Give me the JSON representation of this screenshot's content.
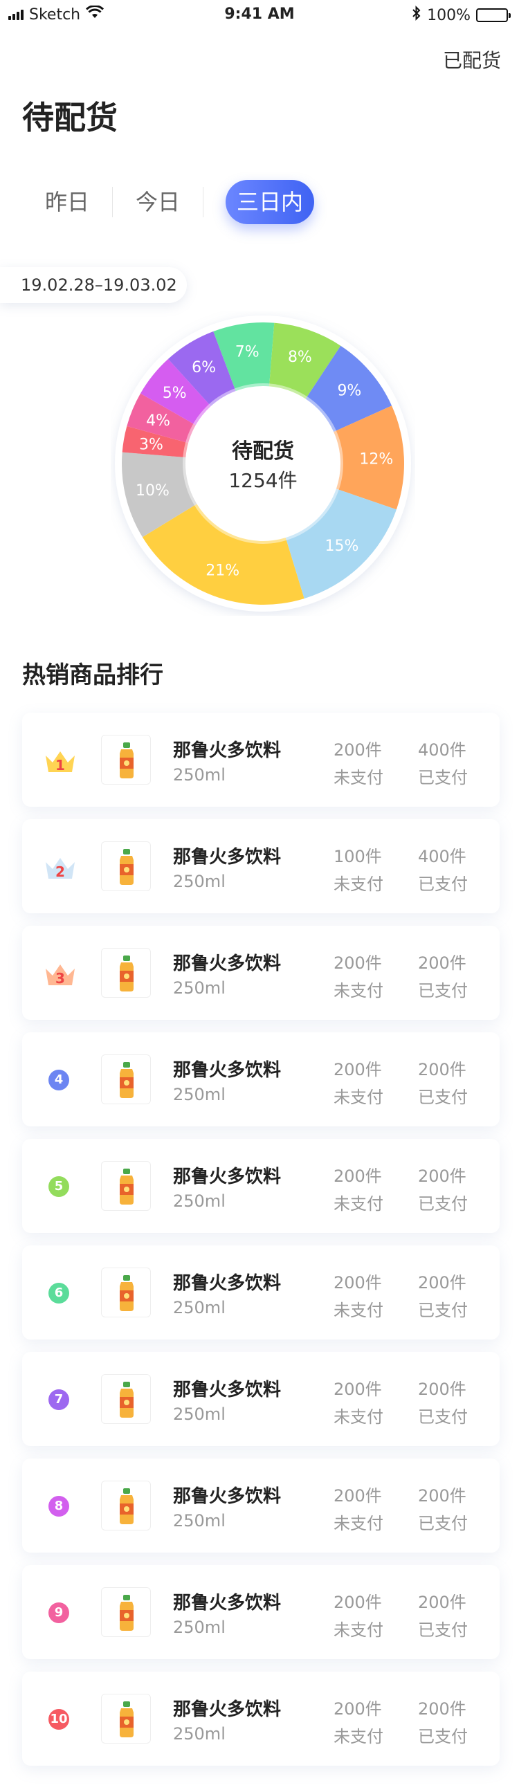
{
  "status_bar": {
    "carrier": "Sketch",
    "time": "9:41 AM",
    "battery": "100%"
  },
  "header": {
    "right_action": "已配货",
    "title": "待配货"
  },
  "tabs": [
    {
      "label": "昨日",
      "active": false
    },
    {
      "label": "今日",
      "active": false
    },
    {
      "label": "三日内",
      "active": true
    }
  ],
  "date_range": "19.02.28–19.03.02",
  "chart_data": {
    "type": "pie",
    "center_title": "待配货",
    "center_value": "1254件",
    "slices": [
      {
        "label": "7%",
        "value": 7,
        "color": "#62e3a0"
      },
      {
        "label": "8%",
        "value": 8,
        "color": "#9be05a"
      },
      {
        "label": "9%",
        "value": 9,
        "color": "#6f8bf4"
      },
      {
        "label": "12%",
        "value": 12,
        "color": "#ffa55a"
      },
      {
        "label": "15%",
        "value": 15,
        "color": "#a8d8f2"
      },
      {
        "label": "21%",
        "value": 21,
        "color": "#ffcf40"
      },
      {
        "label": "10%",
        "value": 10,
        "color": "#c8c8c8"
      },
      {
        "label": "3%",
        "value": 3,
        "color": "#f86470"
      },
      {
        "label": "4%",
        "value": 4,
        "color": "#f2619f"
      },
      {
        "label": "5%",
        "value": 5,
        "color": "#d55df0"
      },
      {
        "label": "6%",
        "value": 6,
        "color": "#9b69f0"
      }
    ]
  },
  "ranking": {
    "title": "热销商品排行",
    "items": [
      {
        "rank": "1",
        "name": "那鲁火多饮料",
        "spec": "250ml",
        "unpaid_count": "200件",
        "unpaid_label": "未支付",
        "paid_count": "400件",
        "paid_label": "已支付",
        "badge": "crown",
        "color": "#ffd24a"
      },
      {
        "rank": "2",
        "name": "那鲁火多饮料",
        "spec": "250ml",
        "unpaid_count": "100件",
        "unpaid_label": "未支付",
        "paid_count": "400件",
        "paid_label": "已支付",
        "badge": "crown",
        "color": "#cfe4f5"
      },
      {
        "rank": "3",
        "name": "那鲁火多饮料",
        "spec": "250ml",
        "unpaid_count": "200件",
        "unpaid_label": "未支付",
        "paid_count": "200件",
        "paid_label": "已支付",
        "badge": "crown",
        "color": "#ffb38c"
      },
      {
        "rank": "4",
        "name": "那鲁火多饮料",
        "spec": "250ml",
        "unpaid_count": "200件",
        "unpaid_label": "未支付",
        "paid_count": "200件",
        "paid_label": "已支付",
        "badge": "circle",
        "color": "#6c85f2"
      },
      {
        "rank": "5",
        "name": "那鲁火多饮料",
        "spec": "250ml",
        "unpaid_count": "200件",
        "unpaid_label": "未支付",
        "paid_count": "200件",
        "paid_label": "已支付",
        "badge": "circle",
        "color": "#93dc5c"
      },
      {
        "rank": "6",
        "name": "那鲁火多饮料",
        "spec": "250ml",
        "unpaid_count": "200件",
        "unpaid_label": "未支付",
        "paid_count": "200件",
        "paid_label": "已支付",
        "badge": "circle",
        "color": "#5bdc9a"
      },
      {
        "rank": "7",
        "name": "那鲁火多饮料",
        "spec": "250ml",
        "unpaid_count": "200件",
        "unpaid_label": "未支付",
        "paid_count": "200件",
        "paid_label": "已支付",
        "badge": "circle",
        "color": "#9d68f0"
      },
      {
        "rank": "8",
        "name": "那鲁火多饮料",
        "spec": "250ml",
        "unpaid_count": "200件",
        "unpaid_label": "未支付",
        "paid_count": "200件",
        "paid_label": "已支付",
        "badge": "circle",
        "color": "#d25fee"
      },
      {
        "rank": "9",
        "name": "那鲁火多饮料",
        "spec": "250ml",
        "unpaid_count": "200件",
        "unpaid_label": "未支付",
        "paid_count": "200件",
        "paid_label": "已支付",
        "badge": "circle",
        "color": "#f2619f"
      },
      {
        "rank": "10",
        "name": "那鲁火多饮料",
        "spec": "250ml",
        "unpaid_count": "200件",
        "unpaid_label": "未支付",
        "paid_count": "200件",
        "paid_label": "已支付",
        "badge": "circle",
        "color": "#f65a62"
      }
    ]
  }
}
